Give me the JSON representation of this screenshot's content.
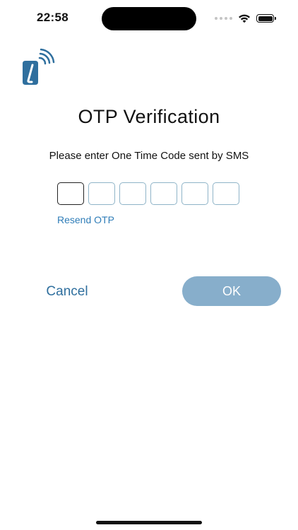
{
  "status_bar": {
    "time": "22:58",
    "icons": [
      "cellular-dots-icon",
      "wifi-icon",
      "battery-icon"
    ]
  },
  "logo": {
    "icon": "phone-signal-logo-icon",
    "colors": {
      "primary": "#2f6f9e",
      "waves": "#2f6f9e"
    }
  },
  "page": {
    "title": "OTP Verification",
    "instruction": "Please enter One Time Code sent by SMS"
  },
  "otp": {
    "digits": [
      "",
      "",
      "",
      "",
      "",
      ""
    ],
    "active_index": 0,
    "resend_label": "Resend OTP"
  },
  "actions": {
    "cancel_label": "Cancel",
    "ok_label": "OK"
  },
  "colors": {
    "accent": "#2f6f9e",
    "link": "#2f7db8",
    "ok_button_disabled": "#87aecb",
    "otp_border": "#8fb4c8",
    "otp_border_active": "#222222"
  }
}
